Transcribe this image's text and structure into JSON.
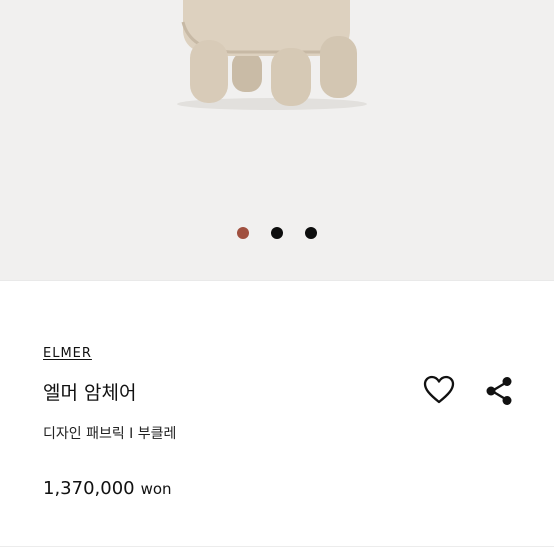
{
  "product": {
    "brand": "ELMER",
    "title": "엘머 암체어",
    "subtitle": "디자인 패브릭 I 부클레",
    "price": "1,370,000",
    "currency": "won"
  },
  "gallery": {
    "slide_count": 3,
    "active_index": 0,
    "active_color": "#a0503f",
    "dot_color": "#0d0d0d"
  },
  "actions": {
    "like_icon": "heart-icon",
    "share_icon": "share-icon"
  }
}
